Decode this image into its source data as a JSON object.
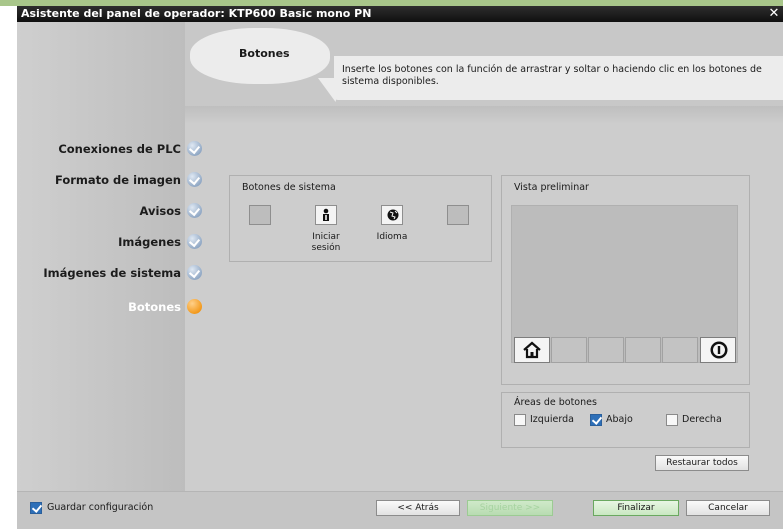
{
  "window": {
    "title": "Asistente del panel de operador: KTP600 Basic mono PN",
    "close_glyph": "✕"
  },
  "header": {
    "section_title": "Botones",
    "description": "Inserte los botones con la función de arrastrar y soltar o haciendo clic en los botones de sistema disponibles."
  },
  "nav": {
    "items": [
      {
        "label": "Conexiones de PLC",
        "state": "done"
      },
      {
        "label": "Formato de imagen",
        "state": "done"
      },
      {
        "label": "Avisos",
        "state": "done"
      },
      {
        "label": "Imágenes",
        "state": "done"
      },
      {
        "label": "Imágenes de sistema",
        "state": "done"
      },
      {
        "label": "Botones",
        "state": "current"
      }
    ]
  },
  "system_buttons": {
    "title": "Botones de sistema",
    "buttons": [
      {
        "icon": "empty-slot",
        "caption": ""
      },
      {
        "icon": "login-person-icon",
        "caption_line1": "Iniciar",
        "caption_line2": "sesión"
      },
      {
        "icon": "language-globe-icon",
        "caption": "Idioma"
      },
      {
        "icon": "empty-slot",
        "caption": ""
      }
    ]
  },
  "preview": {
    "title": "Vista preliminar",
    "slots": [
      "home-icon",
      "",
      "",
      "",
      "",
      "info-icon"
    ]
  },
  "button_areas": {
    "title": "Áreas de botones",
    "options": [
      {
        "label": "Izquierda",
        "checked": false
      },
      {
        "label": "Abajo",
        "checked": true
      },
      {
        "label": "Derecha",
        "checked": false
      }
    ],
    "restore_label": "Restaurar todos"
  },
  "footer": {
    "save_config_label": "Guardar configuración",
    "save_config_checked": true,
    "back_label": "<< Atrás",
    "next_label": "Siguiente >>",
    "finish_label": "Finalizar",
    "cancel_label": "Cancelar"
  },
  "colors": {
    "accent_orange": "#f39a1d",
    "done_blue": "#93aac6",
    "check_blue": "#2d6fb8",
    "titlebar": "#1a1a1a"
  }
}
